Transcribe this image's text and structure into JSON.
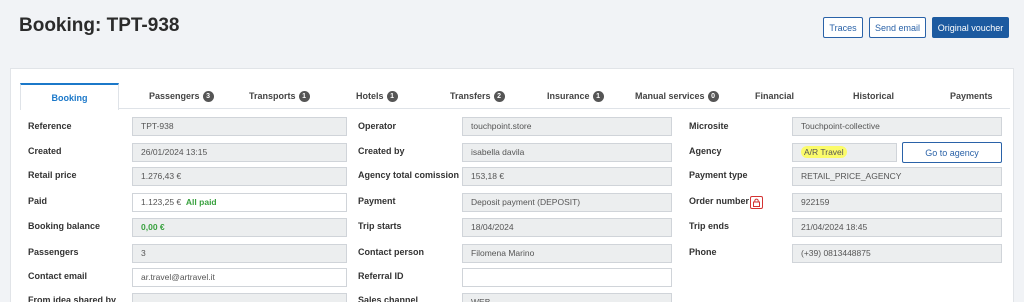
{
  "header": {
    "title": "Booking: TPT-938",
    "traces_label": "Traces",
    "send_email_label": "Send email",
    "original_voucher_label": "Original voucher"
  },
  "tabs": [
    {
      "label": "Booking"
    },
    {
      "label": "Passengers",
      "count": "3"
    },
    {
      "label": "Transports",
      "count": "1"
    },
    {
      "label": "Hotels",
      "count": "1"
    },
    {
      "label": "Transfers",
      "count": "2"
    },
    {
      "label": "Insurance",
      "count": "1"
    },
    {
      "label": "Manual services",
      "count": "0"
    },
    {
      "label": "Financial"
    },
    {
      "label": "Historical"
    },
    {
      "label": "Payments"
    }
  ],
  "col1": {
    "reference": {
      "label": "Reference",
      "value": "TPT-938"
    },
    "created": {
      "label": "Created",
      "value": "26/01/2024 13:15"
    },
    "retail_price": {
      "label": "Retail price",
      "value": "1.276,43 €"
    },
    "paid": {
      "label": "Paid",
      "value": "1.123,25 €",
      "status": "All paid"
    },
    "booking_balance": {
      "label": "Booking balance",
      "value": "0,00 €"
    },
    "passengers": {
      "label": "Passengers",
      "value": "3"
    },
    "contact_email": {
      "label": "Contact email",
      "value": "ar.travel@artravel.it"
    },
    "from_idea": {
      "label": "From idea shared by",
      "value": ""
    }
  },
  "col2": {
    "operator": {
      "label": "Operator",
      "value": "touchpoint.store"
    },
    "created_by": {
      "label": "Created by",
      "value": "isabella davila"
    },
    "agency_commission": {
      "label": "Agency total comission",
      "value": "153,18 €"
    },
    "payment": {
      "label": "Payment",
      "value": "Deposit payment (DEPOSIT)"
    },
    "trip_starts": {
      "label": "Trip starts",
      "value": "18/04/2024"
    },
    "contact_person": {
      "label": "Contact person",
      "value": "Filomena Marino"
    },
    "referral_id": {
      "label": "Referral ID",
      "value": ""
    },
    "sales_channel": {
      "label": "Sales channel",
      "value": "WEB"
    }
  },
  "col3": {
    "microsite": {
      "label": "Microsite",
      "value": "Touchpoint-collective"
    },
    "agency": {
      "label": "Agency",
      "value": "A/R Travel",
      "button": "Go to agency"
    },
    "payment_type": {
      "label": "Payment type",
      "value": "RETAIL_PRICE_AGENCY"
    },
    "order_number": {
      "label": "Order number",
      "value": "922159"
    },
    "trip_ends": {
      "label": "Trip ends",
      "value": "21/04/2024 18:45"
    },
    "phone": {
      "label": "Phone",
      "value": "(+39) 0813448875"
    }
  },
  "colors": {
    "accent": "#1b78c9",
    "primary_button": "#1c5aa0",
    "success": "#39a13f",
    "highlight": "#fbfb6a"
  }
}
